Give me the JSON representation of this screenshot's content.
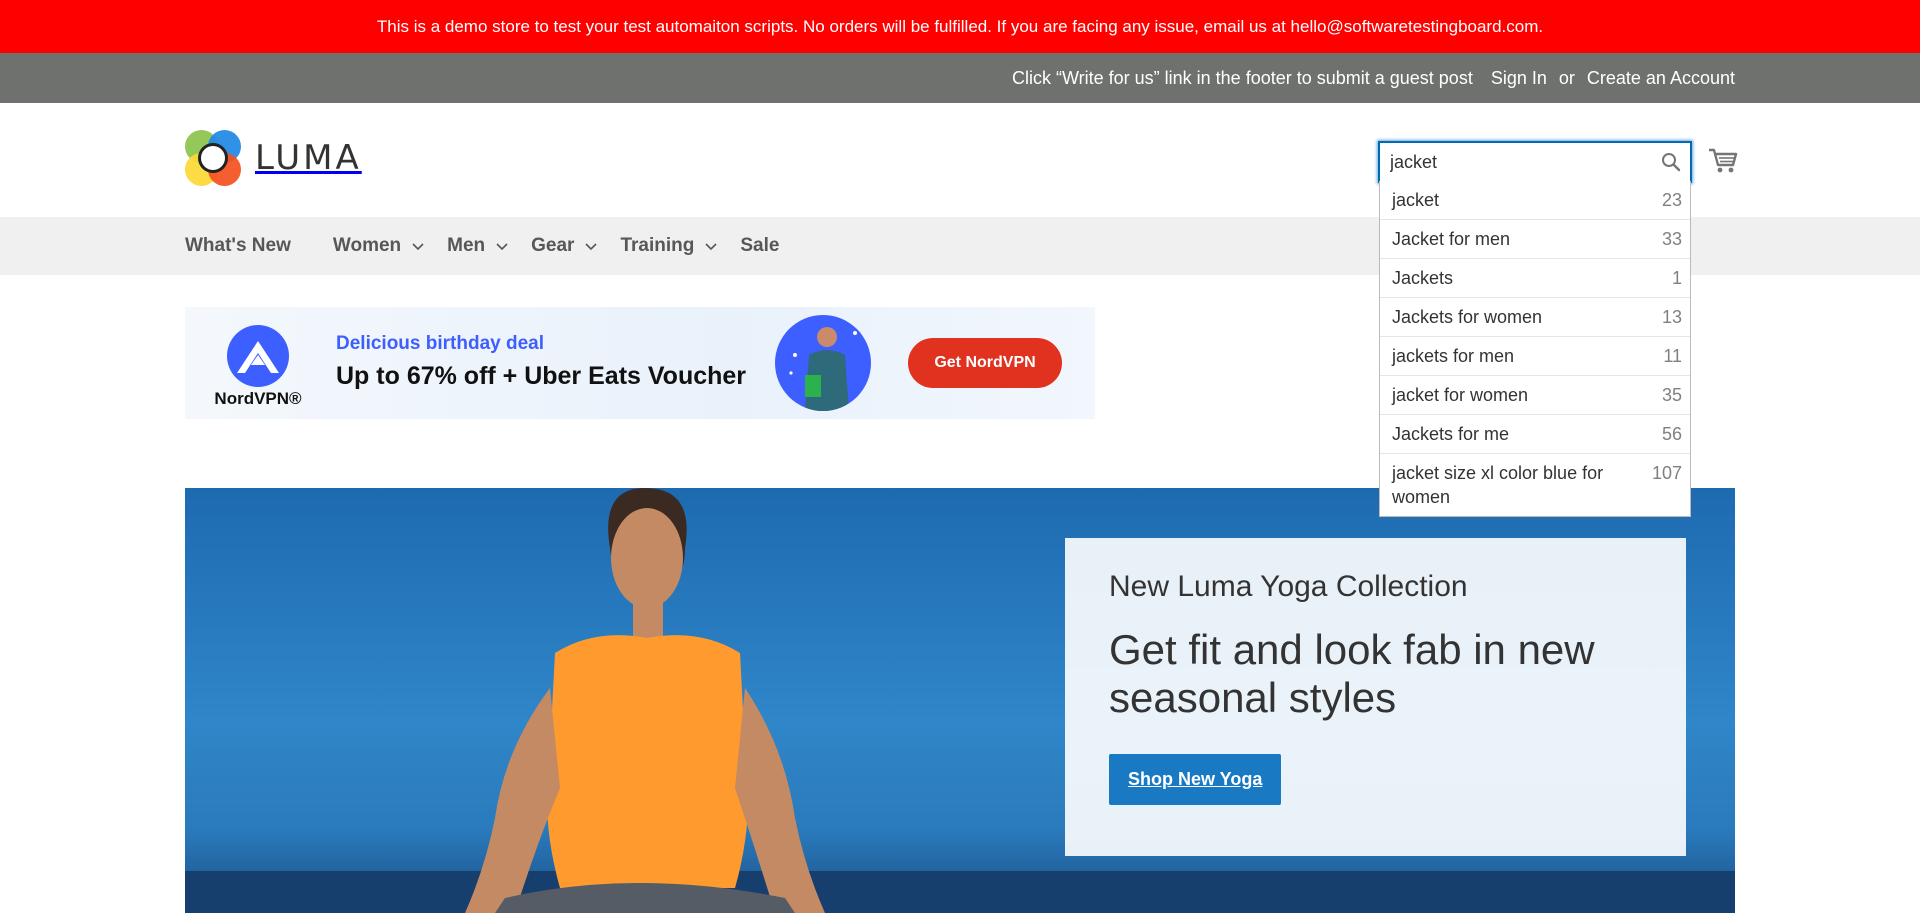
{
  "demo_notice": "This is a demo store to test your test automaiton scripts. No orders will be fulfilled. If you are facing any issue, email us at hello@softwaretestingboard.com.",
  "top_panel": {
    "guest_post": "Click “Write for us” link in the footer to submit a guest post",
    "sign_in": "Sign In",
    "or": "or",
    "create_account": "Create an Account"
  },
  "logo": {
    "text": "LUMA"
  },
  "search": {
    "value": "jacket",
    "icon": "search-icon"
  },
  "cart": {
    "icon": "cart-icon"
  },
  "autocomplete": [
    {
      "term": "jacket",
      "count": "23"
    },
    {
      "term": "Jacket for men",
      "count": "33"
    },
    {
      "term": "Jackets",
      "count": "1"
    },
    {
      "term": "Jackets for women",
      "count": "13"
    },
    {
      "term": "jackets for men",
      "count": "11"
    },
    {
      "term": "jacket for women",
      "count": "35"
    },
    {
      "term": "Jackets for me",
      "count": "56"
    },
    {
      "term": "jacket size xl color blue for women",
      "count": "107"
    }
  ],
  "nav": {
    "whats_new": "What's New",
    "women": "Women",
    "men": "Men",
    "gear": "Gear",
    "training": "Training",
    "sale": "Sale"
  },
  "ad": {
    "brand": "NordVPN®",
    "deal": "Delicious birthday deal",
    "offer": "Up to 67% off + Uber Eats Voucher",
    "cta": "Get NordVPN"
  },
  "hero": {
    "subtitle": "New Luma Yoga Collection",
    "headline": "Get fit and look fab in new seasonal styles",
    "button": "Shop New Yoga"
  },
  "colors": {
    "demo_bar": "#ff0000",
    "top_panel": "#6e716e",
    "accent_blue": "#1979c3",
    "ad_cta": "#e0321f"
  }
}
